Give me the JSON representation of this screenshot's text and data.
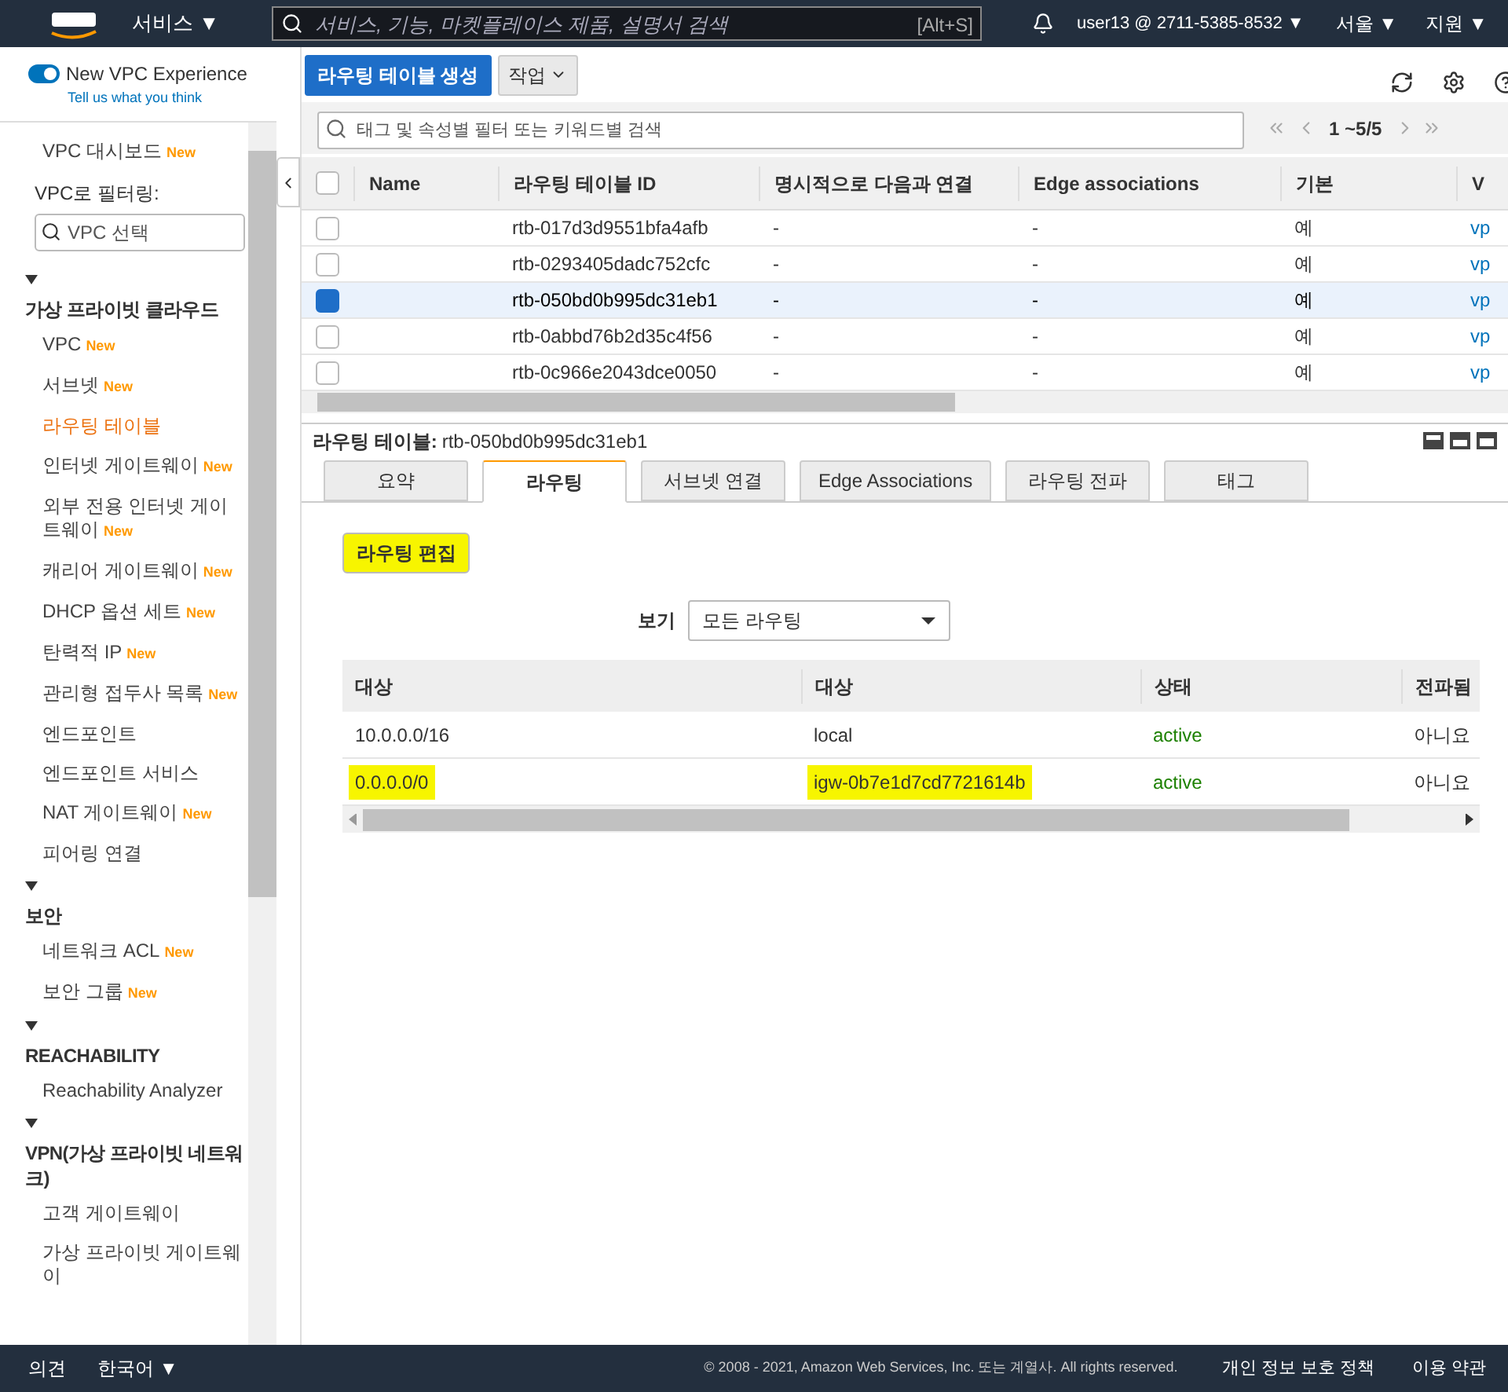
{
  "top_nav": {
    "services": "서비스 ▼",
    "search": {
      "placeholder": "서비스, 기능, 마켓플레이스 제품, 설명서 검색"
    },
    "shortcut": "[Alt+S]",
    "account": "user13 @ 2711-5385-8532 ▼",
    "region": "서울 ▼",
    "support": "지원 ▼"
  },
  "sidebar": {
    "toggle": {
      "label": "New VPC Experience",
      "sublabel": "Tell us what you think",
      "on": true
    },
    "items": [
      {
        "kind": "link",
        "label": "VPC 대시보드",
        "new": "New",
        "selected": false
      },
      {
        "kind": "label",
        "label": "VPC로 필터링:"
      },
      {
        "kind": "search",
        "placeholder": "VPC 선택"
      },
      {
        "kind": "section",
        "label": "가상 프라이빗 클라우드",
        "expanded": true
      },
      {
        "kind": "link",
        "label": "VPC",
        "new": "New",
        "selected": false
      },
      {
        "kind": "link",
        "label": "서브넷",
        "new": "New",
        "selected": false
      },
      {
        "kind": "link",
        "label": "라우팅 테이블",
        "selected": true
      },
      {
        "kind": "link",
        "label": "인터넷 게이트웨이",
        "new": "New",
        "selected": false
      },
      {
        "kind": "link",
        "label": "외부 전용 인터넷 게이트웨이",
        "new": "New",
        "selected": false
      },
      {
        "kind": "link",
        "label": "캐리어 게이트웨이",
        "new": "New",
        "selected": false
      },
      {
        "kind": "link",
        "label": "DHCP 옵션 세트",
        "new": "New",
        "selected": false
      },
      {
        "kind": "link",
        "label": "탄력적 IP",
        "new": "New",
        "selected": false
      },
      {
        "kind": "link",
        "label": "관리형 접두사 목록",
        "new": "New",
        "selected": false
      },
      {
        "kind": "link",
        "label": "엔드포인트",
        "selected": false
      },
      {
        "kind": "link",
        "label": "엔드포인트 서비스",
        "selected": false
      },
      {
        "kind": "link",
        "label": "NAT 게이트웨이",
        "new": "New",
        "selected": false
      },
      {
        "kind": "link",
        "label": "피어링 연결",
        "selected": false
      },
      {
        "kind": "section",
        "label": "보안",
        "expanded": true
      },
      {
        "kind": "link",
        "label": "네트워크 ACL",
        "new": "New",
        "selected": false
      },
      {
        "kind": "link",
        "label": "보안 그룹",
        "new": "New",
        "selected": false
      },
      {
        "kind": "section",
        "label": "REACHABILITY",
        "expanded": true
      },
      {
        "kind": "link",
        "label": "Reachability Analyzer",
        "selected": false
      },
      {
        "kind": "section",
        "label": "VPN(가상 프라이빗 네트워크)",
        "expanded": true
      },
      {
        "kind": "link",
        "label": "고객 게이트웨이",
        "selected": false
      },
      {
        "kind": "link",
        "label": "가상 프라이빗 게이트웨이",
        "selected": false
      }
    ]
  },
  "toolbar": {
    "create_button": "라우팅 테이블 생성",
    "actions_button": "작업"
  },
  "filter": {
    "placeholder": "태그 및 속성별 필터 또는 키워드별 검색",
    "pagination": "1 ~5/5"
  },
  "table": {
    "select_all": {
      "checked": false
    },
    "columns": [
      "Name",
      "라우팅 테이블 ID",
      "명시적으로 다음과 연결",
      "Edge associations",
      "기본",
      "V"
    ],
    "rows": [
      {
        "id": "rtb-017d3d9551bfa4afb",
        "explicit": "-",
        "edge": "-",
        "main": "예",
        "vpc": "vp",
        "selected": false
      },
      {
        "id": "rtb-0293405dadc752cfc",
        "explicit": "-",
        "edge": "-",
        "main": "예",
        "vpc": "vp",
        "selected": false
      },
      {
        "id": "rtb-050bd0b995dc31eb1",
        "explicit": "-",
        "edge": "-",
        "main": "예",
        "vpc": "vp",
        "selected": true
      },
      {
        "id": "rtb-0abbd76b2d35c4f56",
        "explicit": "-",
        "edge": "-",
        "main": "예",
        "vpc": "vp",
        "selected": false
      },
      {
        "id": "rtb-0c966e2043dce0050",
        "explicit": "-",
        "edge": "-",
        "main": "예",
        "vpc": "vp",
        "selected": false
      }
    ]
  },
  "detail": {
    "label": "라우팅 테이블:",
    "value": "rtb-050bd0b995dc31eb1",
    "tabs": [
      {
        "label": "요약",
        "selected": false
      },
      {
        "label": "라우팅",
        "selected": true
      },
      {
        "label": "서브넷 연결",
        "selected": false
      },
      {
        "label": "Edge Associations",
        "selected": false
      },
      {
        "label": "라우팅 전파",
        "selected": false
      },
      {
        "label": "태그",
        "selected": false
      }
    ],
    "edit_button": {
      "label": "라우팅 편집",
      "highlighted": true
    },
    "view_label": "보기",
    "view_select": "모든 라우팅",
    "routes": {
      "columns": [
        "대상",
        "대상",
        "상태",
        "전파됨"
      ],
      "rows": [
        {
          "destination": "10.0.0.0/16",
          "destination_highlighted": false,
          "target": "local",
          "target_highlighted": false,
          "status": "active",
          "propagated": "아니요"
        },
        {
          "destination": "0.0.0.0/0",
          "destination_highlighted": true,
          "target": "igw-0b7e1d7cd7721614b",
          "target_highlighted": true,
          "status": "active",
          "propagated": "아니요"
        }
      ]
    }
  },
  "footer": {
    "feedback": "의견",
    "language": "한국어 ▼",
    "copyright": "© 2008 - 2021, Amazon Web Services, Inc. 또는 계열사. All rights reserved.",
    "privacy": "개인 정보 보호 정책",
    "terms": "이용 약관"
  }
}
